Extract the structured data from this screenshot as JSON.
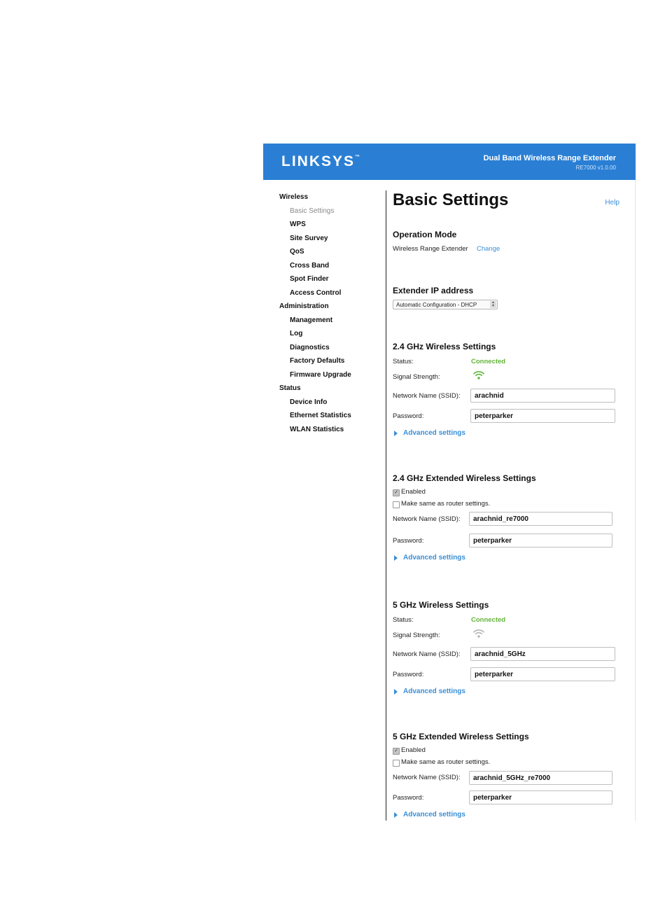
{
  "header": {
    "logo_text": "LINKSYS",
    "logo_tm": "™",
    "product_title": "Dual Band Wireless Range Extender",
    "product_version": "RE7000 v1.0.00"
  },
  "sidebar": {
    "items": [
      {
        "label": "Wireless",
        "level": 0
      },
      {
        "label": "Basic Settings",
        "level": 1,
        "active": true
      },
      {
        "label": "WPS",
        "level": 1
      },
      {
        "label": "Site Survey",
        "level": 1
      },
      {
        "label": "QoS",
        "level": 1
      },
      {
        "label": "Cross Band",
        "level": 1
      },
      {
        "label": "Spot Finder",
        "level": 1
      },
      {
        "label": "Access Control",
        "level": 1
      },
      {
        "label": "Administration",
        "level": 0
      },
      {
        "label": "Management",
        "level": 1
      },
      {
        "label": "Log",
        "level": 1
      },
      {
        "label": "Diagnostics",
        "level": 1
      },
      {
        "label": "Factory Defaults",
        "level": 1
      },
      {
        "label": "Firmware Upgrade",
        "level": 1
      },
      {
        "label": "Status",
        "level": 0
      },
      {
        "label": "Device Info",
        "level": 1
      },
      {
        "label": "Ethernet Statistics",
        "level": 1
      },
      {
        "label": "WLAN Statistics",
        "level": 1
      }
    ]
  },
  "main": {
    "title": "Basic Settings",
    "help_label": "Help",
    "operation_mode": {
      "heading": "Operation Mode",
      "value": "Wireless Range Extender",
      "change_label": "Change"
    },
    "extender_ip": {
      "heading": "Extender IP address",
      "selected": "Automatic Configuration - DHCP"
    },
    "ghz24": {
      "heading": "2.4 GHz Wireless Settings",
      "status_label": "Status:",
      "status_value": "Connected",
      "signal_label": "Signal Strength:",
      "ssid_label": "Network Name (SSID):",
      "ssid_value": "arachnid",
      "password_label": "Password:",
      "password_value": "peterparker",
      "advanced_label": "Advanced settings"
    },
    "ghz24_ext": {
      "heading": "2.4 GHz Extended Wireless Settings",
      "enabled_label": "Enabled",
      "enabled_checked": true,
      "same_label": "Make same as router settings.",
      "same_checked": false,
      "ssid_label": "Network Name (SSID):",
      "ssid_value": "arachnid_re7000",
      "password_label": "Password:",
      "password_value": "peterparker",
      "advanced_label": "Advanced settings"
    },
    "ghz5": {
      "heading": "5 GHz Wireless Settings",
      "status_label": "Status:",
      "status_value": "Connected",
      "signal_label": "Signal Strength:",
      "ssid_label": "Network Name (SSID):",
      "ssid_value": "arachnid_5GHz",
      "password_label": "Password:",
      "password_value": "peterparker",
      "advanced_label": "Advanced settings"
    },
    "ghz5_ext": {
      "heading": "5 GHz Extended Wireless Settings",
      "enabled_label": "Enabled",
      "enabled_checked": true,
      "same_label": "Make same as router settings.",
      "same_checked": false,
      "ssid_label": "Network Name (SSID):",
      "ssid_value": "arachnid_5GHz_re7000",
      "password_label": "Password:",
      "password_value": "peterparker",
      "advanced_label": "Advanced settings"
    }
  },
  "colors": {
    "header_bg": "#2a7fd4",
    "link": "#3a8fd6",
    "connected": "#64b33c",
    "signal_strong": "#5cb83a",
    "signal_weak": "#b5b5b5"
  },
  "icons": {
    "signal_24": "wifi-signal-strong-icon",
    "signal_5": "wifi-signal-weak-icon",
    "advanced": "triangle-right-icon",
    "select_arrow": "updown-arrows-icon",
    "checkbox": "checkmark-icon"
  }
}
